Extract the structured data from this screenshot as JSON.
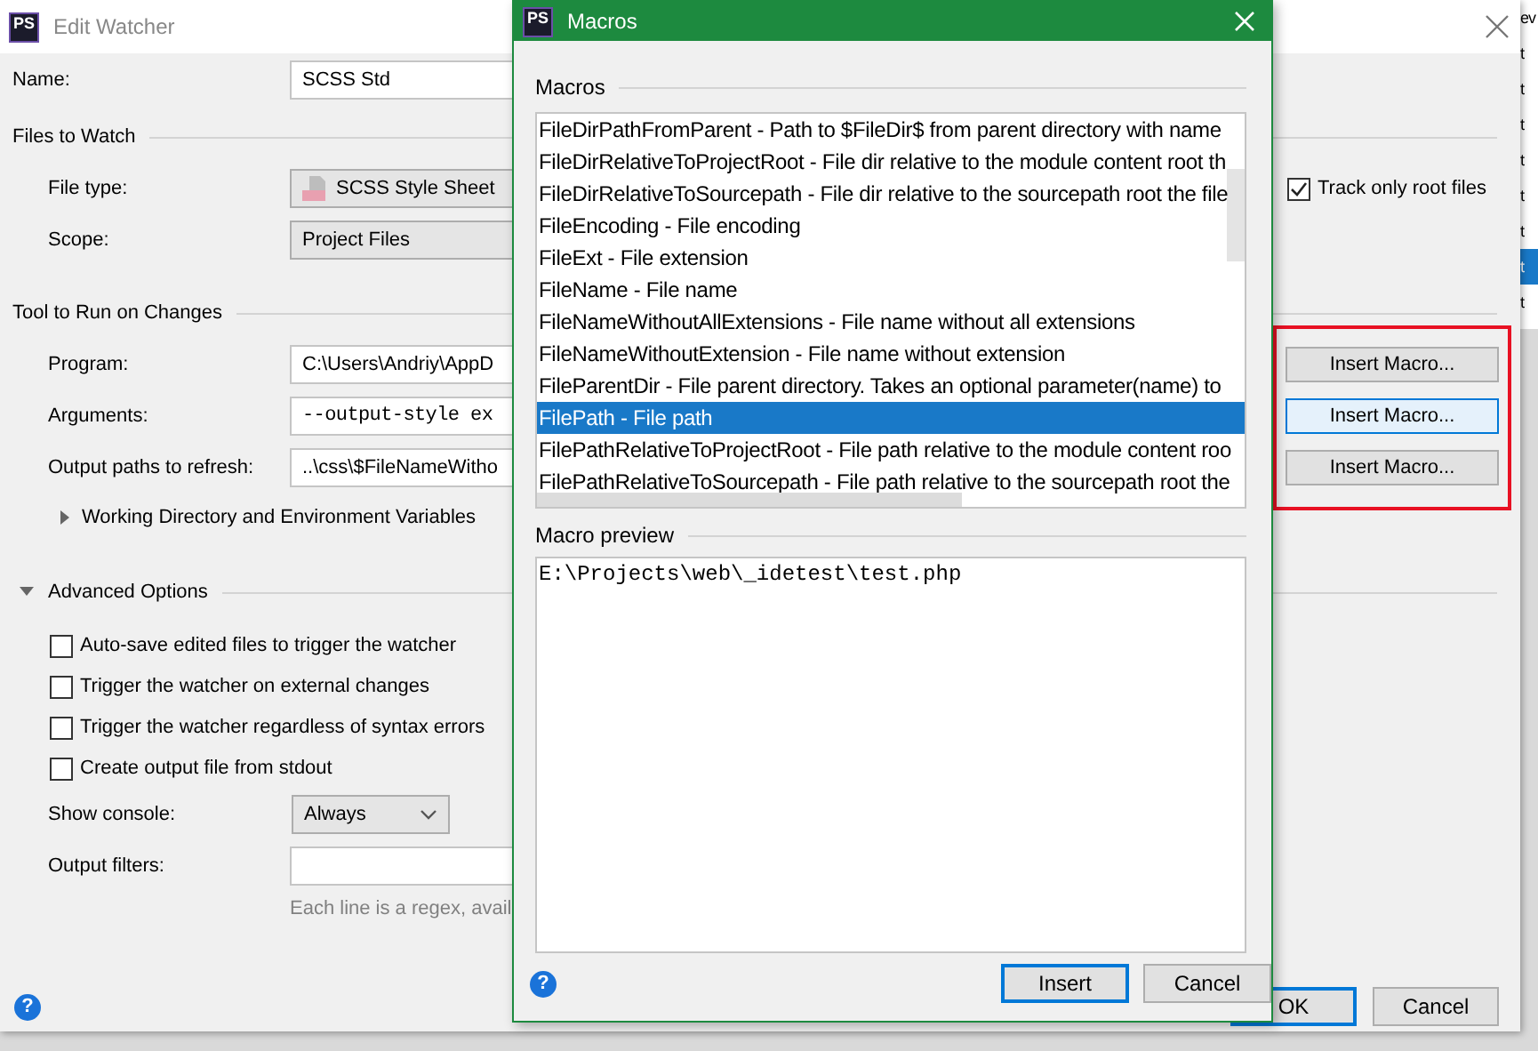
{
  "window": {
    "icon_text": "PS",
    "title": "Edit Watcher"
  },
  "name": {
    "label": "Name:",
    "value": "SCSS Std"
  },
  "files_to_watch": {
    "title": "Files to Watch",
    "file_type": {
      "label": "File type:",
      "value": "SCSS Style Sheet"
    },
    "scope": {
      "label": "Scope:",
      "value": "Project Files"
    },
    "track_only_root": {
      "label": "Track only root files",
      "checked": true
    }
  },
  "tool": {
    "title": "Tool to Run on Changes",
    "fields": [
      {
        "label": "Program:",
        "value": "C:\\Users\\Andriy\\AppD",
        "monospace": false,
        "insert_button": {
          "label": "Insert Macro...",
          "highlighted": false
        }
      },
      {
        "label": "Arguments:",
        "value": "--output-style ex",
        "monospace": true,
        "insert_button": {
          "label": "Insert Macro...",
          "highlighted": true
        }
      },
      {
        "label": "Output paths to refresh:",
        "value": "..\\css\\$FileNameWitho",
        "monospace": false,
        "insert_button": {
          "label": "Insert Macro...",
          "highlighted": false
        }
      }
    ],
    "working_dir": {
      "label": "Working Directory and Environment Variables",
      "expanded": false
    }
  },
  "advanced": {
    "title": "Advanced Options",
    "expanded": true,
    "checkboxes": [
      {
        "label": "Auto-save edited files to trigger the watcher",
        "checked": false
      },
      {
        "label": "Trigger the watcher on external changes",
        "checked": false
      },
      {
        "label": "Trigger the watcher regardless of syntax errors",
        "checked": false
      },
      {
        "label": "Create output file from stdout",
        "checked": false
      }
    ],
    "show_console": {
      "label": "Show console:",
      "value": "Always"
    },
    "output_filters": {
      "label": "Output filters:"
    },
    "hint": "Each line is a regex, avail"
  },
  "help": "?",
  "buttons": [
    {
      "label": "OK",
      "default": true
    },
    {
      "label": "Cancel",
      "default": false
    }
  ],
  "annotation_frame": true,
  "macros_dialog": {
    "icon_text": "PS",
    "title": "Macros",
    "list_title": "Macros",
    "items": [
      {
        "text": "FileDirPathFromParent - Path to $FileDir$ from parent directory with name",
        "selected": false
      },
      {
        "text": "FileDirRelativeToProjectRoot - File dir relative to the module content root th",
        "selected": false
      },
      {
        "text": "FileDirRelativeToSourcepath - File dir relative to the sourcepath root the file",
        "selected": false
      },
      {
        "text": "FileEncoding - File encoding",
        "selected": false
      },
      {
        "text": "FileExt - File extension",
        "selected": false
      },
      {
        "text": "FileName - File name",
        "selected": false
      },
      {
        "text": "FileNameWithoutAllExtensions - File name without all extensions",
        "selected": false
      },
      {
        "text": "FileNameWithoutExtension - File name without extension",
        "selected": false
      },
      {
        "text": "FileParentDir - File parent directory. Takes an optional parameter(name) to",
        "selected": false
      },
      {
        "text": "FilePath - File path",
        "selected": true
      },
      {
        "text": "FilePathRelativeToProjectRoot - File path relative to the module content roo",
        "selected": false
      },
      {
        "text": "FilePathRelativeToSourcepath - File path relative to the sourcepath root the",
        "selected": false
      }
    ],
    "preview_title": "Macro preview",
    "preview": "E:\\Projects\\web\\_idetest\\test.php",
    "help": "?",
    "buttons": [
      {
        "label": "Insert",
        "default": true
      },
      {
        "label": "Cancel",
        "default": false
      }
    ]
  },
  "behind_window": {
    "rows": [
      {
        "text": "ev",
        "selected": false
      },
      {
        "text": "t",
        "selected": false
      },
      {
        "text": "t",
        "selected": false
      },
      {
        "text": "t",
        "selected": false
      },
      {
        "text": "t",
        "selected": false
      },
      {
        "text": "t",
        "selected": false
      },
      {
        "text": "t",
        "selected": false
      },
      {
        "text": "t",
        "selected": true
      },
      {
        "text": "t",
        "selected": false
      }
    ]
  }
}
